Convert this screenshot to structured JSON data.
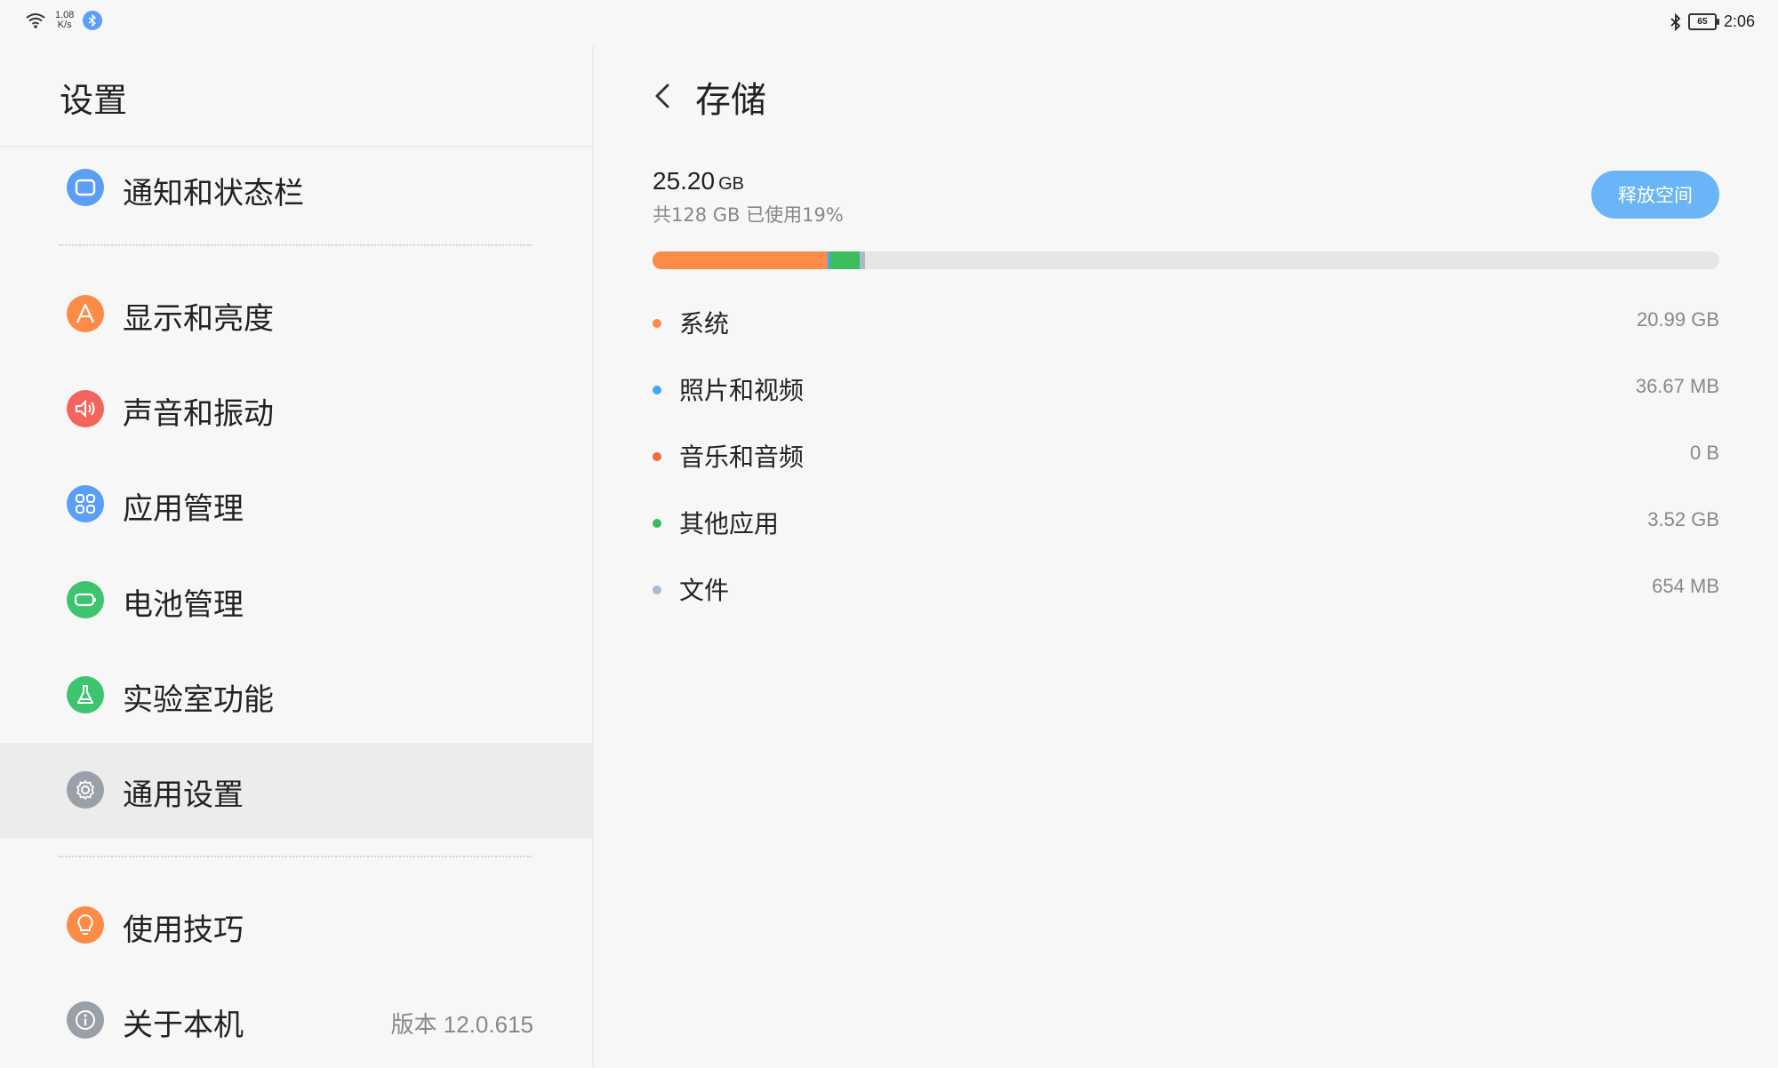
{
  "status_bar": {
    "net_speed_value": "1.08",
    "net_speed_unit": "K/s",
    "battery_level": "65",
    "time": "2:06",
    "icons": [
      "wifi-icon",
      "bluetooth-badge-icon",
      "bluetooth-icon",
      "battery-icon"
    ]
  },
  "left_panel": {
    "title": "设置",
    "items": [
      {
        "label": "通知和状态栏",
        "icon": "notification-icon",
        "color": "#5a9ef5"
      },
      {
        "label": "显示和亮度",
        "icon": "display-icon",
        "color": "#fb8c48"
      },
      {
        "label": "声音和振动",
        "icon": "sound-icon",
        "color": "#f2645c"
      },
      {
        "label": "应用管理",
        "icon": "apps-icon",
        "color": "#5a9ef5"
      },
      {
        "label": "电池管理",
        "icon": "battery-icon",
        "color": "#3cc46e"
      },
      {
        "label": "实验室功能",
        "icon": "lab-icon",
        "color": "#3cc46e"
      },
      {
        "label": "通用设置",
        "icon": "gear-icon",
        "color": "#9aa0a8",
        "active": true
      },
      {
        "label": "使用技巧",
        "icon": "bulb-icon",
        "color": "#fb8c48"
      },
      {
        "label": "关于本机",
        "icon": "info-icon",
        "color": "#9aa0a8",
        "detail": "版本 12.0.615"
      }
    ]
  },
  "storage": {
    "title": "存储",
    "used_value": "25.20",
    "used_unit": "GB",
    "subtitle": "共128 GB 已使用19%",
    "free_button": "释放空间",
    "usage_fraction": 0.19,
    "categories": [
      {
        "label": "系统",
        "size": "20.99 GB",
        "color": "#fb8c48",
        "fraction": 0.164
      },
      {
        "label": "照片和视频",
        "size": "36.67 MB",
        "color": "#3fa9f5",
        "fraction": 0.003
      },
      {
        "label": "音乐和音频",
        "size": "0 B",
        "color": "#f26a3c",
        "fraction": 0.0
      },
      {
        "label": "其他应用",
        "size": "3.52 GB",
        "color": "#3cbc5c",
        "fraction": 0.0275
      },
      {
        "label": "文件",
        "size": "654 MB",
        "color": "#a9b9d2",
        "fraction": 0.005
      }
    ]
  }
}
